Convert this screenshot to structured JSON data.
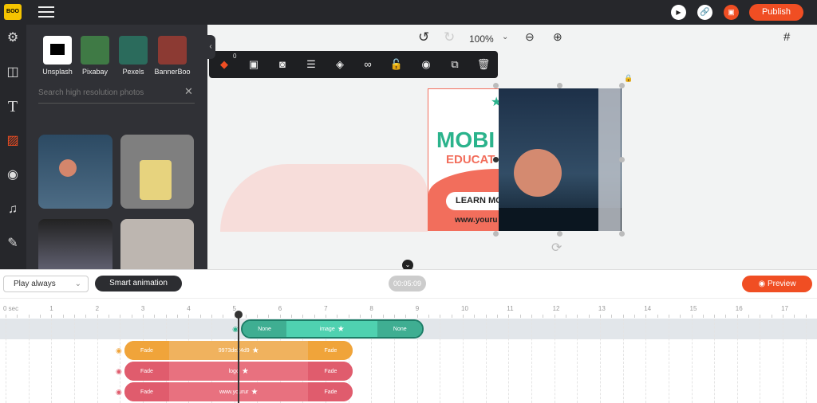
{
  "topbar": {
    "menu_icon": "hamburger-icon",
    "publish_label": "Publish",
    "icons": [
      "play-circle-icon",
      "link-icon",
      "save-icon"
    ]
  },
  "sidebar": {
    "items": [
      "settings-icon",
      "layout-icon",
      "text-icon",
      "image-icon",
      "video-icon",
      "music-icon",
      "brush-icon"
    ],
    "active": 3
  },
  "panel": {
    "sources": [
      {
        "label": "Unsplash",
        "color": "#ffffff"
      },
      {
        "label": "Pixabay",
        "color": "#3f7a45"
      },
      {
        "label": "Pexels",
        "color": "#2b6b5c"
      },
      {
        "label": "BannerBoo",
        "color": "#8c3a33"
      }
    ],
    "search_placeholder": "Search high resolution photos"
  },
  "canvas": {
    "zoom": "100%",
    "selection_count": "0",
    "banner": {
      "title": "MOBI",
      "subtitle": "EDUCAT",
      "button": "LEARN MO",
      "url": "www.youru"
    }
  },
  "toolbar": {
    "icons": [
      "eraser-icon",
      "image-icon",
      "mask-icon",
      "adjust-icon",
      "layers-icon",
      "link-icon",
      "unlock-icon",
      "eye-icon",
      "duplicate-icon",
      "trash-icon"
    ]
  },
  "timeline": {
    "play_mode": "Play always",
    "smart_label": "Smart animation",
    "time": "00:05:09",
    "preview_label": "Preview",
    "ruler": [
      "0 sec",
      "1",
      "2",
      "3",
      "4",
      "5",
      "6",
      "7",
      "8",
      "9",
      "10",
      "11",
      "12",
      "13",
      "14",
      "15",
      "16",
      "17"
    ],
    "playhead_sec": 5.1,
    "tracks": [
      {
        "name": "image",
        "in": "None",
        "out": "None",
        "start": 5.15,
        "end": 9.15,
        "color": "#4fd1b0"
      },
      {
        "name": "9973de24d9",
        "in": "Fade",
        "out": "Fade",
        "start": 2.6,
        "end": 7.6,
        "color": "#f0b25e"
      },
      {
        "name": "logo",
        "in": "Fade",
        "out": "Fade",
        "start": 2.6,
        "end": 7.6,
        "color": "#e8717f"
      },
      {
        "name": "www.yourur",
        "in": "Fade",
        "out": "Fade",
        "start": 2.6,
        "end": 7.6,
        "color": "#e8717f"
      }
    ]
  },
  "colors": {
    "accent": "#f04e23",
    "teal": "#2bb38c",
    "salmon": "#f26e5c"
  }
}
